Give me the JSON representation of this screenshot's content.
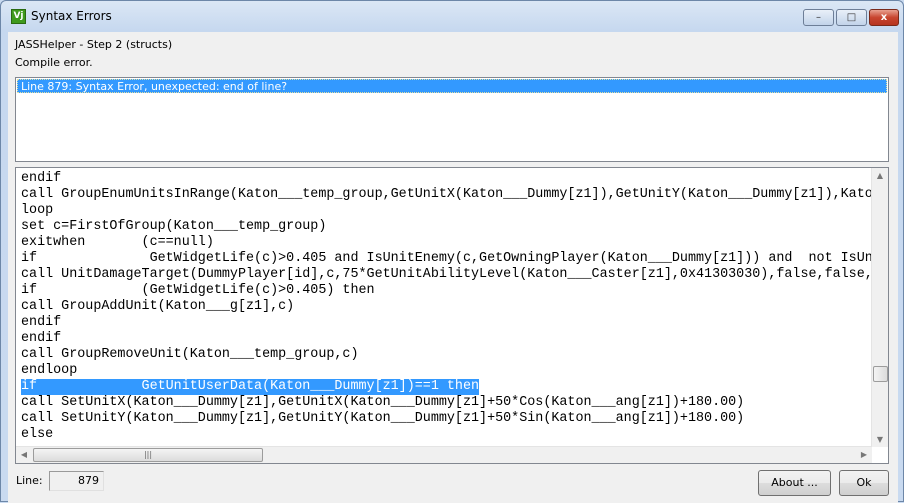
{
  "window": {
    "title": "Syntax Errors",
    "app_icon_text": "Vj",
    "minimize": "–",
    "maximize": "□",
    "close": "x"
  },
  "header": {
    "step": "JASSHelper - Step 2 (structs)",
    "status": "Compile error."
  },
  "errors": [
    "Line 879: Syntax Error, unexpected: end of line?"
  ],
  "code": {
    "selected_index": 13,
    "lines": [
      "endif",
      "call GroupEnumUnitsInRange(Katon___temp_group,GetUnitX(Katon___Dummy[z1]),GetUnitY(Katon___Dummy[z1]),Kato",
      "loop",
      "set c=FirstOfGroup(Katon___temp_group)",
      "exitwhen       (c==null)",
      "if              GetWidgetLife(c)>0.405 and IsUnitEnemy(c,GetOwningPlayer(Katon___Dummy[z1])) and  not IsUni",
      "call UnitDamageTarget(DummyPlayer[id],c,75*GetUnitAbilityLevel(Katon___Caster[z1],0x41303030),false,false,.",
      "if             (GetWidgetLife(c)>0.405) then",
      "call GroupAddUnit(Katon___g[z1],c)",
      "endif",
      "endif",
      "call GroupRemoveUnit(Katon___temp_group,c)",
      "endloop",
      "if             GetUnitUserData(Katon___Dummy[z1])==1 then",
      "call SetUnitX(Katon___Dummy[z1],GetUnitX(Katon___Dummy[z1]+50*Cos(Katon___ang[z1])+180.00)",
      "call SetUnitY(Katon___Dummy[z1],GetUnitY(Katon___Dummy[z1]+50*Sin(Katon___ang[z1])+180.00)",
      "else"
    ]
  },
  "footer": {
    "line_label": "Line:",
    "line_value": "879",
    "about_label": "About ...",
    "ok_label": "Ok"
  }
}
